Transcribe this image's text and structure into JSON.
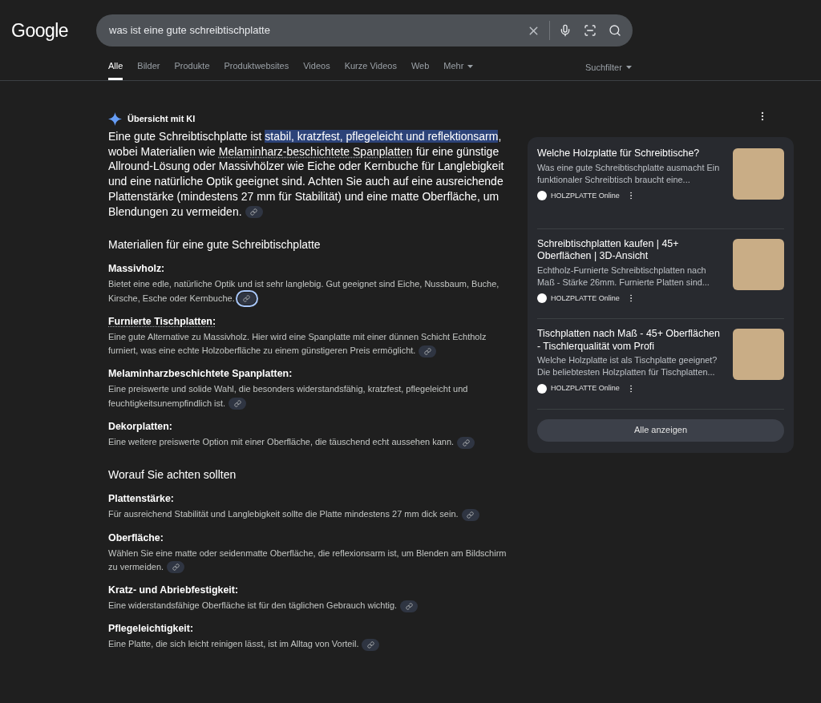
{
  "logo": "Google",
  "search": {
    "value": "was ist eine gute schreibtischplatte"
  },
  "tabs": [
    {
      "label": "Alle",
      "selected": true,
      "menu": false
    },
    {
      "label": "Bilder",
      "selected": false,
      "menu": false
    },
    {
      "label": "Produkte",
      "selected": false,
      "menu": false
    },
    {
      "label": "Produktwebsites",
      "selected": false,
      "menu": false
    },
    {
      "label": "Videos",
      "selected": false,
      "menu": false
    },
    {
      "label": "Kurze Videos",
      "selected": false,
      "menu": false
    },
    {
      "label": "Web",
      "selected": false,
      "menu": false
    },
    {
      "label": "Mehr",
      "selected": false,
      "menu": true
    }
  ],
  "filter": {
    "label": "Suchfilter"
  },
  "ai_overview": {
    "title": "Übersicht mit KI",
    "intro": [
      {
        "kind": "plain",
        "text": "Eine gute Schreibtischplatte ist "
      },
      {
        "kind": "highlight",
        "text": "stabil, kratzfest, pflegeleicht und reflektionsarm"
      },
      {
        "kind": "plain",
        "text": ", wobei Materialien wie "
      },
      {
        "kind": "underline",
        "text": "Melaminharz-beschichtete Spanplatten"
      },
      {
        "kind": "plain",
        "text": " für eine günstige Allround-Lösung oder Massivhölzer wie Eiche oder Kernbuche für Langlebigkeit und eine natürliche Optik geeignet sind. Achten Sie auch auf eine ausreichende Plattenstärke (mindestens 27 mm für Stabilität) und eine matte Oberfläche, um Blendungen zu vermeiden."
      }
    ],
    "intro_link_focused": false,
    "sections": [
      {
        "heading": "Materialien für eine gute Schreibtischplatte",
        "items": [
          {
            "label": "Massivholz:",
            "underlined": false,
            "text": "Bietet eine edle, natürliche Optik und ist sehr langlebig. Gut geeignet sind Eiche, Nussbaum, Buche, Kirsche, Esche oder Kernbuche.",
            "link_focused": true
          },
          {
            "label": "Furnierte Tischplatten:",
            "underlined": true,
            "text": "Eine gute Alternative zu Massivholz. Hier wird eine Spanplatte mit einer dünnen Schicht Echtholz furniert, was eine echte Holzoberfläche zu einem günstigeren Preis ermöglicht.",
            "link_focused": false
          },
          {
            "label": "Melaminharzbeschichtete Spanplatten:",
            "underlined": false,
            "text": "Eine preiswerte und solide Wahl, die besonders widerstandsfähig, kratzfest, pflegeleicht und feuchtigkeitsunempfindlich ist.",
            "link_focused": false
          },
          {
            "label": "Dekorplatten:",
            "underlined": false,
            "text": "Eine weitere preiswerte Option mit einer Oberfläche, die täuschend echt aussehen kann.",
            "link_focused": false
          }
        ]
      },
      {
        "heading": "Worauf Sie achten sollten",
        "items": [
          {
            "label": "Plattenstärke:",
            "underlined": false,
            "text": "Für ausreichend Stabilität und Langlebigkeit sollte die Platte mindestens 27 mm dick sein.",
            "link_focused": false
          },
          {
            "label": "Oberfläche:",
            "underlined": false,
            "text": "Wählen Sie eine matte oder seidenmatte Oberfläche, die reflexionsarm ist, um Blenden am Bildschirm zu vermeiden.",
            "link_focused": false
          },
          {
            "label": "Kratz- und Abriebfestigkeit:",
            "underlined": false,
            "text": "Eine widerstandsfähige Oberfläche ist für den täglichen Gebrauch wichtig.",
            "link_focused": false
          },
          {
            "label": "Pflegeleichtigkeit:",
            "underlined": false,
            "text": "Eine Platte, die sich leicht reinigen lässt, ist im Alltag von Vorteil.",
            "link_focused": false
          }
        ]
      }
    ]
  },
  "sources": {
    "cards": [
      {
        "title": "Welche Holzplatte für Schreibtische?",
        "snippet": "Was eine gute Schreibtischplatte ausmacht Ein funktionaler Schreibtisch braucht eine...",
        "site": "HOLZPLATTE Online"
      },
      {
        "title": "Schreibtischplatten kaufen | 45+ Oberflächen | 3D-Ansicht",
        "snippet": "Echtholz-Furnierte Schreibtischplatten nach Maß - Stärke 26mm. Furnierte Platten sind...",
        "site": "HOLZPLATTE Online"
      },
      {
        "title": "Tischplatten nach Maß - 45+ Oberflächen - Tischlerqualität vom Profi",
        "snippet": "Welche Holzplatte ist als Tischplatte geeignet? Die beliebtesten Holzplatten für Tischplatten...",
        "site": "HOLZPLATTE Online"
      }
    ],
    "show_all": "Alle anzeigen"
  }
}
